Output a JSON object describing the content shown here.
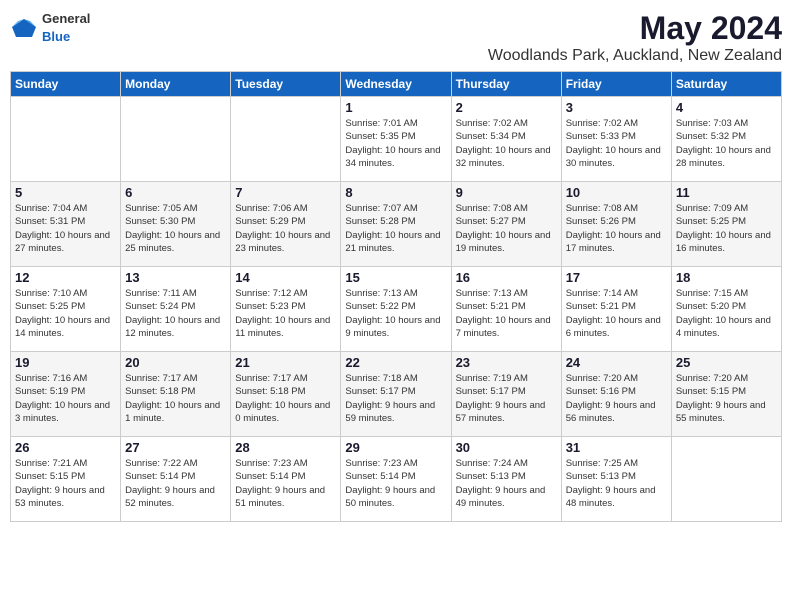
{
  "logo": {
    "general": "General",
    "blue": "Blue"
  },
  "title": "May 2024",
  "location": "Woodlands Park, Auckland, New Zealand",
  "headers": [
    "Sunday",
    "Monday",
    "Tuesday",
    "Wednesday",
    "Thursday",
    "Friday",
    "Saturday"
  ],
  "weeks": [
    [
      {
        "day": "",
        "sunrise": "",
        "sunset": "",
        "daylight": ""
      },
      {
        "day": "",
        "sunrise": "",
        "sunset": "",
        "daylight": ""
      },
      {
        "day": "",
        "sunrise": "",
        "sunset": "",
        "daylight": ""
      },
      {
        "day": "1",
        "sunrise": "Sunrise: 7:01 AM",
        "sunset": "Sunset: 5:35 PM",
        "daylight": "Daylight: 10 hours and 34 minutes."
      },
      {
        "day": "2",
        "sunrise": "Sunrise: 7:02 AM",
        "sunset": "Sunset: 5:34 PM",
        "daylight": "Daylight: 10 hours and 32 minutes."
      },
      {
        "day": "3",
        "sunrise": "Sunrise: 7:02 AM",
        "sunset": "Sunset: 5:33 PM",
        "daylight": "Daylight: 10 hours and 30 minutes."
      },
      {
        "day": "4",
        "sunrise": "Sunrise: 7:03 AM",
        "sunset": "Sunset: 5:32 PM",
        "daylight": "Daylight: 10 hours and 28 minutes."
      }
    ],
    [
      {
        "day": "5",
        "sunrise": "Sunrise: 7:04 AM",
        "sunset": "Sunset: 5:31 PM",
        "daylight": "Daylight: 10 hours and 27 minutes."
      },
      {
        "day": "6",
        "sunrise": "Sunrise: 7:05 AM",
        "sunset": "Sunset: 5:30 PM",
        "daylight": "Daylight: 10 hours and 25 minutes."
      },
      {
        "day": "7",
        "sunrise": "Sunrise: 7:06 AM",
        "sunset": "Sunset: 5:29 PM",
        "daylight": "Daylight: 10 hours and 23 minutes."
      },
      {
        "day": "8",
        "sunrise": "Sunrise: 7:07 AM",
        "sunset": "Sunset: 5:28 PM",
        "daylight": "Daylight: 10 hours and 21 minutes."
      },
      {
        "day": "9",
        "sunrise": "Sunrise: 7:08 AM",
        "sunset": "Sunset: 5:27 PM",
        "daylight": "Daylight: 10 hours and 19 minutes."
      },
      {
        "day": "10",
        "sunrise": "Sunrise: 7:08 AM",
        "sunset": "Sunset: 5:26 PM",
        "daylight": "Daylight: 10 hours and 17 minutes."
      },
      {
        "day": "11",
        "sunrise": "Sunrise: 7:09 AM",
        "sunset": "Sunset: 5:25 PM",
        "daylight": "Daylight: 10 hours and 16 minutes."
      }
    ],
    [
      {
        "day": "12",
        "sunrise": "Sunrise: 7:10 AM",
        "sunset": "Sunset: 5:25 PM",
        "daylight": "Daylight: 10 hours and 14 minutes."
      },
      {
        "day": "13",
        "sunrise": "Sunrise: 7:11 AM",
        "sunset": "Sunset: 5:24 PM",
        "daylight": "Daylight: 10 hours and 12 minutes."
      },
      {
        "day": "14",
        "sunrise": "Sunrise: 7:12 AM",
        "sunset": "Sunset: 5:23 PM",
        "daylight": "Daylight: 10 hours and 11 minutes."
      },
      {
        "day": "15",
        "sunrise": "Sunrise: 7:13 AM",
        "sunset": "Sunset: 5:22 PM",
        "daylight": "Daylight: 10 hours and 9 minutes."
      },
      {
        "day": "16",
        "sunrise": "Sunrise: 7:13 AM",
        "sunset": "Sunset: 5:21 PM",
        "daylight": "Daylight: 10 hours and 7 minutes."
      },
      {
        "day": "17",
        "sunrise": "Sunrise: 7:14 AM",
        "sunset": "Sunset: 5:21 PM",
        "daylight": "Daylight: 10 hours and 6 minutes."
      },
      {
        "day": "18",
        "sunrise": "Sunrise: 7:15 AM",
        "sunset": "Sunset: 5:20 PM",
        "daylight": "Daylight: 10 hours and 4 minutes."
      }
    ],
    [
      {
        "day": "19",
        "sunrise": "Sunrise: 7:16 AM",
        "sunset": "Sunset: 5:19 PM",
        "daylight": "Daylight: 10 hours and 3 minutes."
      },
      {
        "day": "20",
        "sunrise": "Sunrise: 7:17 AM",
        "sunset": "Sunset: 5:18 PM",
        "daylight": "Daylight: 10 hours and 1 minute."
      },
      {
        "day": "21",
        "sunrise": "Sunrise: 7:17 AM",
        "sunset": "Sunset: 5:18 PM",
        "daylight": "Daylight: 10 hours and 0 minutes."
      },
      {
        "day": "22",
        "sunrise": "Sunrise: 7:18 AM",
        "sunset": "Sunset: 5:17 PM",
        "daylight": "Daylight: 9 hours and 59 minutes."
      },
      {
        "day": "23",
        "sunrise": "Sunrise: 7:19 AM",
        "sunset": "Sunset: 5:17 PM",
        "daylight": "Daylight: 9 hours and 57 minutes."
      },
      {
        "day": "24",
        "sunrise": "Sunrise: 7:20 AM",
        "sunset": "Sunset: 5:16 PM",
        "daylight": "Daylight: 9 hours and 56 minutes."
      },
      {
        "day": "25",
        "sunrise": "Sunrise: 7:20 AM",
        "sunset": "Sunset: 5:15 PM",
        "daylight": "Daylight: 9 hours and 55 minutes."
      }
    ],
    [
      {
        "day": "26",
        "sunrise": "Sunrise: 7:21 AM",
        "sunset": "Sunset: 5:15 PM",
        "daylight": "Daylight: 9 hours and 53 minutes."
      },
      {
        "day": "27",
        "sunrise": "Sunrise: 7:22 AM",
        "sunset": "Sunset: 5:14 PM",
        "daylight": "Daylight: 9 hours and 52 minutes."
      },
      {
        "day": "28",
        "sunrise": "Sunrise: 7:23 AM",
        "sunset": "Sunset: 5:14 PM",
        "daylight": "Daylight: 9 hours and 51 minutes."
      },
      {
        "day": "29",
        "sunrise": "Sunrise: 7:23 AM",
        "sunset": "Sunset: 5:14 PM",
        "daylight": "Daylight: 9 hours and 50 minutes."
      },
      {
        "day": "30",
        "sunrise": "Sunrise: 7:24 AM",
        "sunset": "Sunset: 5:13 PM",
        "daylight": "Daylight: 9 hours and 49 minutes."
      },
      {
        "day": "31",
        "sunrise": "Sunrise: 7:25 AM",
        "sunset": "Sunset: 5:13 PM",
        "daylight": "Daylight: 9 hours and 48 minutes."
      },
      {
        "day": "",
        "sunrise": "",
        "sunset": "",
        "daylight": ""
      }
    ]
  ]
}
